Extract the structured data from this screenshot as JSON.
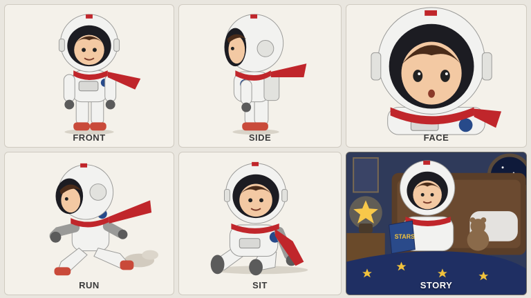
{
  "panels": [
    {
      "id": "front",
      "label": "FRONT"
    },
    {
      "id": "side",
      "label": "SIDE"
    },
    {
      "id": "face",
      "label": "FACE"
    },
    {
      "id": "run",
      "label": "RUN"
    },
    {
      "id": "sit",
      "label": "SIT"
    },
    {
      "id": "story",
      "label": "STORY"
    }
  ],
  "book_title": "STARS",
  "colors": {
    "background": "#e9e6df",
    "panel": "#f4f1ea",
    "suit": "#f2f2f0",
    "scarf": "#c0262b",
    "visor": "#1c1c22",
    "skin": "#f3c9a3",
    "hair": "#4a2c1a",
    "night": "#2b3550",
    "blanket": "#1f2f63",
    "star": "#f1c23c"
  }
}
